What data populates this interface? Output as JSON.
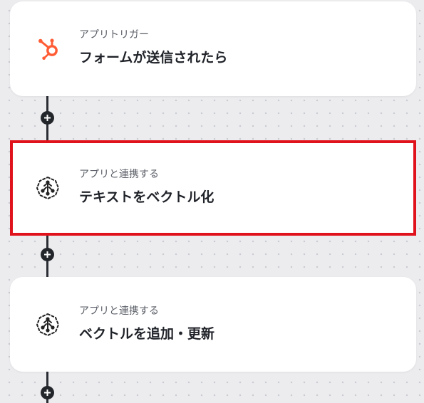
{
  "flow": {
    "steps": [
      {
        "subtitle": "アプリトリガー",
        "title": "フォームが送信されたら",
        "icon": "hubspot-icon",
        "icon_color": "#ff5c35",
        "selected": false
      },
      {
        "subtitle": "アプリと連携する",
        "title": "テキストをベクトル化",
        "icon": "vector-ai-icon",
        "icon_color": "#222222",
        "selected": true
      },
      {
        "subtitle": "アプリと連携する",
        "title": "ベクトルを追加・更新",
        "icon": "vector-ai-icon",
        "icon_color": "#222222",
        "selected": false
      }
    ],
    "colors": {
      "canvas_background": "#ececef",
      "card_background": "#ffffff",
      "connector": "#2a2d33",
      "selection_outline": "#e0121b"
    }
  }
}
